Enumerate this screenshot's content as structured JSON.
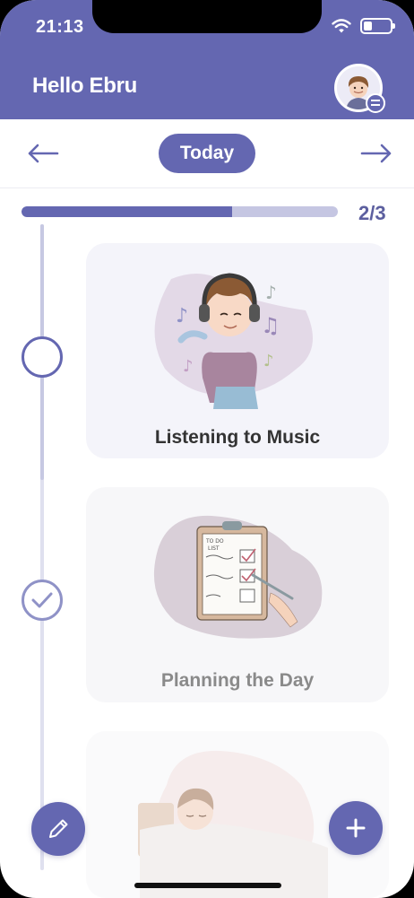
{
  "status_bar": {
    "time": "21:13",
    "icons": [
      "wifi-icon",
      "battery-icon"
    ]
  },
  "header": {
    "greeting": "Hello Ebru",
    "avatar_badge_icon": "menu-icon"
  },
  "date_nav": {
    "prev_icon": "arrow-left-icon",
    "label": "Today",
    "next_icon": "arrow-right-icon"
  },
  "progress": {
    "completed": 2,
    "total": 3,
    "text": "2/3",
    "fraction": 0.665
  },
  "activities": [
    {
      "label": "Listening to Music",
      "status": "pending"
    },
    {
      "label": "Planning the Day",
      "status": "done"
    },
    {
      "label": "",
      "status": "pending"
    }
  ],
  "actions": {
    "edit_icon": "pencil-icon",
    "add_icon": "plus-icon"
  },
  "colors": {
    "primary": "#6467b1",
    "progress_track": "#c5c6e2",
    "card_bg": "#f4f4fa"
  }
}
